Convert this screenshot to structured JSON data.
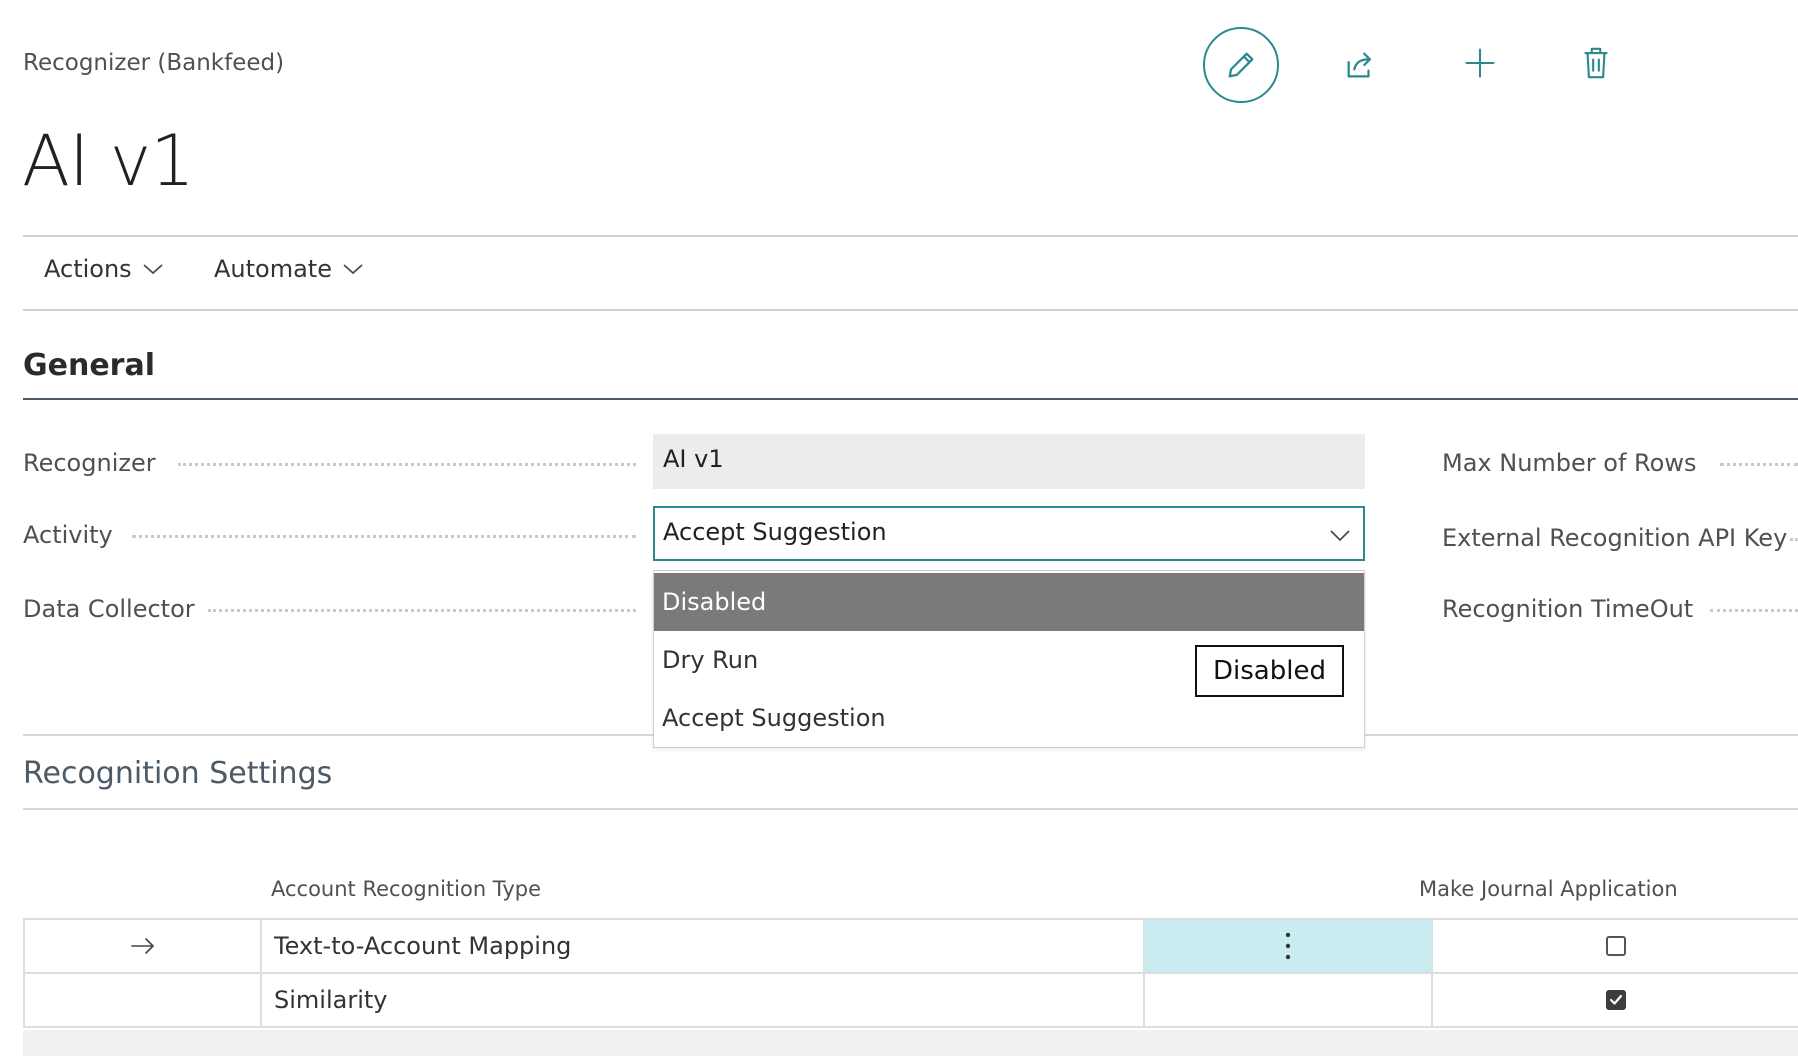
{
  "header": {
    "breadcrumb": "Recognizer (Bankfeed)",
    "title": "AI v1"
  },
  "toolbar": {
    "edit_icon": "pencil-icon",
    "share_icon": "share-icon",
    "new_icon": "plus-icon",
    "delete_icon": "trash-icon"
  },
  "action_menu": {
    "actions_label": "Actions",
    "automate_label": "Automate"
  },
  "general": {
    "section_title": "General",
    "left_fields": {
      "recognizer_label": "Recognizer",
      "recognizer_value": "AI v1",
      "activity_label": "Activity",
      "activity_value": "Accept Suggestion",
      "data_collector_label": "Data Collector"
    },
    "right_fields": {
      "max_rows_label": "Max Number of Rows",
      "api_key_label": "External Recognition API Key",
      "timeout_label": "Recognition TimeOut"
    },
    "activity_dropdown": {
      "options": [
        "Disabled",
        "Dry Run",
        "Accept Suggestion"
      ],
      "highlighted": "Disabled",
      "tooltip": "Disabled"
    }
  },
  "recognition_settings": {
    "section_title": "Recognition Settings",
    "columns": {
      "type": "Account Recognition Type",
      "make_journal": "Make Journal Application"
    },
    "rows": [
      {
        "type": "Text-to-Account Mapping",
        "make_journal": false,
        "current": true
      },
      {
        "type": "Similarity",
        "make_journal": true,
        "current": false
      }
    ]
  },
  "colors": {
    "accent": "#2b8a8d",
    "selected_cell": "#c9ecf0",
    "dropdown_highlight": "#7a7a7a"
  }
}
